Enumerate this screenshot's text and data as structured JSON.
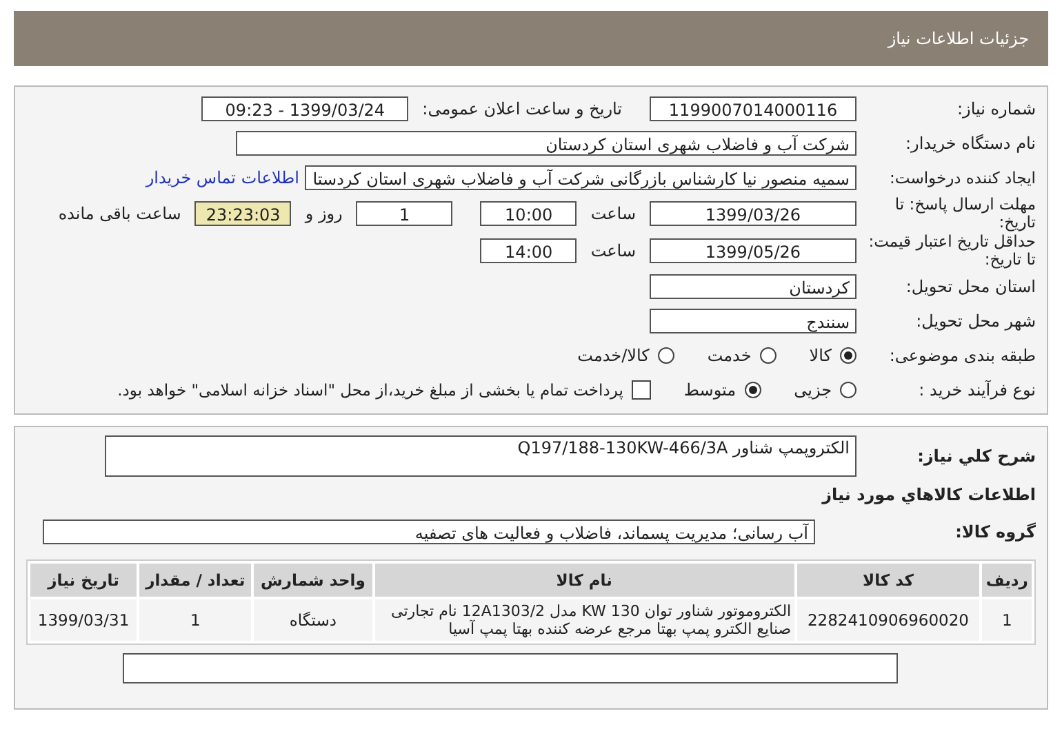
{
  "header": {
    "title": "جزئیات اطلاعات نیاز"
  },
  "details": {
    "need_number": {
      "label": "شماره نیاز:",
      "value": "1199007014000116"
    },
    "announce": {
      "label": "تاریخ و ساعت اعلان عمومی:",
      "value": "1399/03/24 - 09:23"
    },
    "buyer": {
      "label": "نام دستگاه خریدار:",
      "value": "شرکت آب و فاضلاب شهری استان کردستان"
    },
    "creator": {
      "label": "ایجاد کننده درخواست:",
      "value": "سمیه منصور نیا کارشناس بازرگانی شرکت آب و فاضلاب شهری استان کردستا",
      "link": "اطلاعات تماس خریدار"
    },
    "deadline": {
      "label": "مهلت ارسال پاسخ: تا تاریخ:",
      "date": "1399/03/26",
      "time_label": "ساعت",
      "time": "10:00",
      "days": "1",
      "days_label": "روز و",
      "remaining": "23:23:03",
      "remaining_label": "ساعت باقی مانده"
    },
    "validity": {
      "label": "حداقل تاریخ اعتبار قیمت: تا تاریخ:",
      "date": "1399/05/26",
      "time_label": "ساعت",
      "time": "14:00"
    },
    "province": {
      "label": "استان محل تحویل:",
      "value": "کردستان"
    },
    "city": {
      "label": "شهر محل تحویل:",
      "value": "سنندج"
    },
    "category": {
      "label": "طبقه بندی موضوعی:",
      "options": [
        {
          "label": "کالا",
          "selected": true
        },
        {
          "label": "خدمت",
          "selected": false
        },
        {
          "label": "کالا/خدمت",
          "selected": false
        }
      ]
    },
    "process": {
      "label": "نوع فرآیند خرید :",
      "options": [
        {
          "label": "جزیی",
          "selected": false
        },
        {
          "label": "متوسط",
          "selected": true
        }
      ],
      "payment": {
        "checked": false,
        "text": "پرداخت تمام یا بخشی از مبلغ خرید،از محل \"اسناد خزانه اسلامی\" خواهد بود."
      }
    }
  },
  "goods": {
    "description": {
      "label": "شرح کلي نیاز:",
      "value": "الکتروپمپ شناور Q197/188-130KW-466/3A"
    },
    "heading": "اطلاعات کالاهاي مورد نیاز",
    "group": {
      "label": "گروه کالا:",
      "value": "آب رسانی؛ مدیریت پسماند، فاضلاب و فعالیت های تصفیه"
    },
    "table": {
      "columns": [
        "ردیف",
        "کد کالا",
        "نام کالا",
        "واحد شمارش",
        "تعداد / مقدار",
        "تاریخ نیاز"
      ],
      "rows": [
        [
          "1",
          "2282410906960020",
          "الکتروموتور شناور توان 130 KW مدل 12A1303/2 نام تجارتی صنایع الکترو پمپ بهتا مرجع عرضه کننده بهتا پمپ آسیا",
          "دستگاه",
          "1",
          "1399/03/31"
        ]
      ]
    }
  }
}
